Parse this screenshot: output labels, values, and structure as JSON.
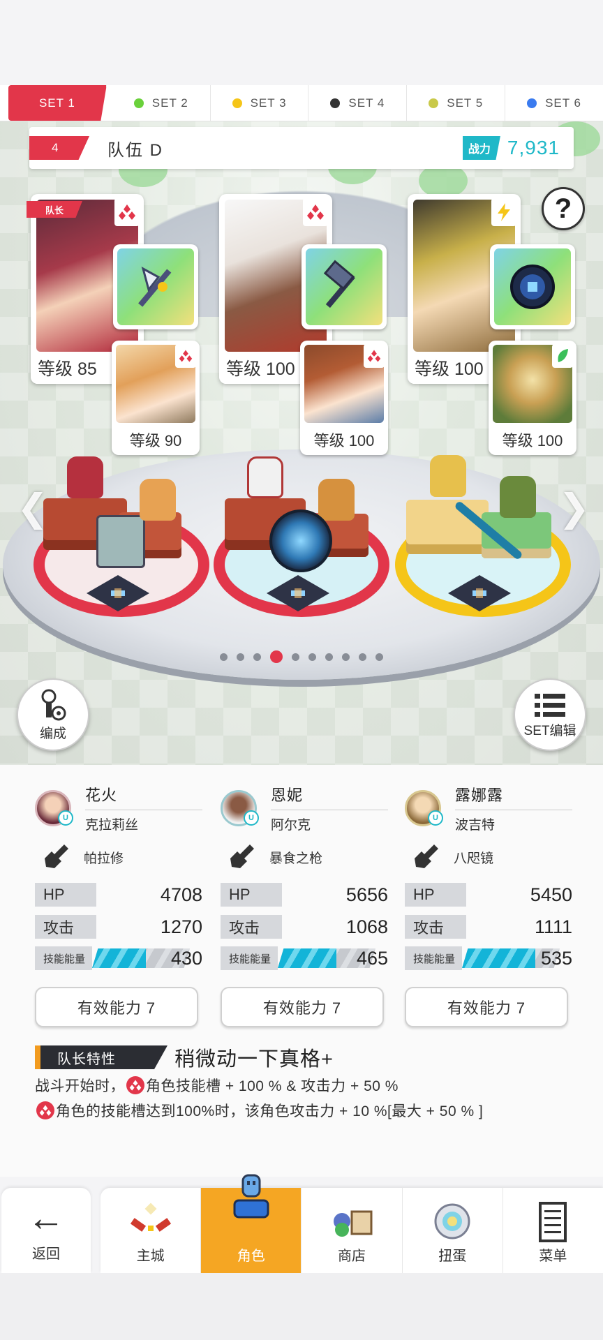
{
  "set_tabs": [
    {
      "label": "SET 1",
      "color": "",
      "active": true
    },
    {
      "label": "SET 2",
      "color": "#6ad13b",
      "active": false
    },
    {
      "label": "SET 3",
      "color": "#f5c518",
      "active": false
    },
    {
      "label": "SET 4",
      "color": "#333333",
      "active": false
    },
    {
      "label": "SET 5",
      "color": "#c9c94a",
      "active": false
    },
    {
      "label": "SET 6",
      "color": "#3a7bef",
      "active": false
    }
  ],
  "team": {
    "number": "4",
    "name": "队伍 D",
    "power_label": "战力",
    "power_value": "7,931"
  },
  "help_label": "?",
  "leader_tag": "队长",
  "cards": [
    {
      "level": "等级 85",
      "element": "red-diamond-icon",
      "weapon": "axe-icon",
      "partner_level": "等级 90"
    },
    {
      "level": "等级 100",
      "element": "red-diamond-icon",
      "weapon": "hammer-icon",
      "partner_level": "等级 100"
    },
    {
      "level": "等级 100",
      "element": "lightning-icon",
      "weapon": "shield-orb-icon",
      "partner_level": "等级 100"
    }
  ],
  "pager": {
    "count": 10,
    "active_index": 3
  },
  "side_buttons": {
    "formation": "编成",
    "set_edit": "SET编辑"
  },
  "characters": [
    {
      "name": "花火",
      "partner": "克拉莉丝",
      "weapon": "帕拉修",
      "hp_label": "HP",
      "hp": "4708",
      "atk_label": "攻击",
      "atk": "1270",
      "energy_label": "技能能量",
      "energy": "430",
      "energy_fill": 0.55,
      "ability": "有效能力 7"
    },
    {
      "name": "恩妮",
      "partner": "阿尔克",
      "weapon": "暴食之枪",
      "hp_label": "HP",
      "hp": "5656",
      "atk_label": "攻击",
      "atk": "1068",
      "energy_label": "技能能量",
      "energy": "465",
      "energy_fill": 0.6,
      "ability": "有效能力 7"
    },
    {
      "name": "露娜露",
      "partner": "波吉特",
      "weapon": "八咫镜",
      "hp_label": "HP",
      "hp": "5450",
      "atk_label": "攻击",
      "atk": "1111",
      "energy_label": "技能能量",
      "energy": "535",
      "energy_fill": 0.75,
      "ability": "有效能力 7"
    }
  ],
  "leader_skill": {
    "tag": "队长特性",
    "title": "稍微动一下真格+",
    "line1_prefix": "战斗开始时，",
    "line1_suffix": "角色技能槽 + 100 % & 攻击力 + 50 %",
    "line2_suffix": "角色的技能槽达到100%时，该角色攻击力 + 10 %[最大 + 50 % ]"
  },
  "nav": {
    "back": "返回",
    "items": [
      {
        "label": "主城",
        "icon": "castle-icon",
        "active": false
      },
      {
        "label": "角色",
        "icon": "character-icon",
        "active": true
      },
      {
        "label": "商店",
        "icon": "shop-icon",
        "active": false
      },
      {
        "label": "扭蛋",
        "icon": "gacha-icon",
        "active": false
      },
      {
        "label": "菜单",
        "icon": "menu-list-icon",
        "active": false
      }
    ]
  },
  "colors": {
    "accent_red": "#e2364a",
    "accent_teal": "#1fb8c8",
    "accent_orange": "#f5a623"
  }
}
